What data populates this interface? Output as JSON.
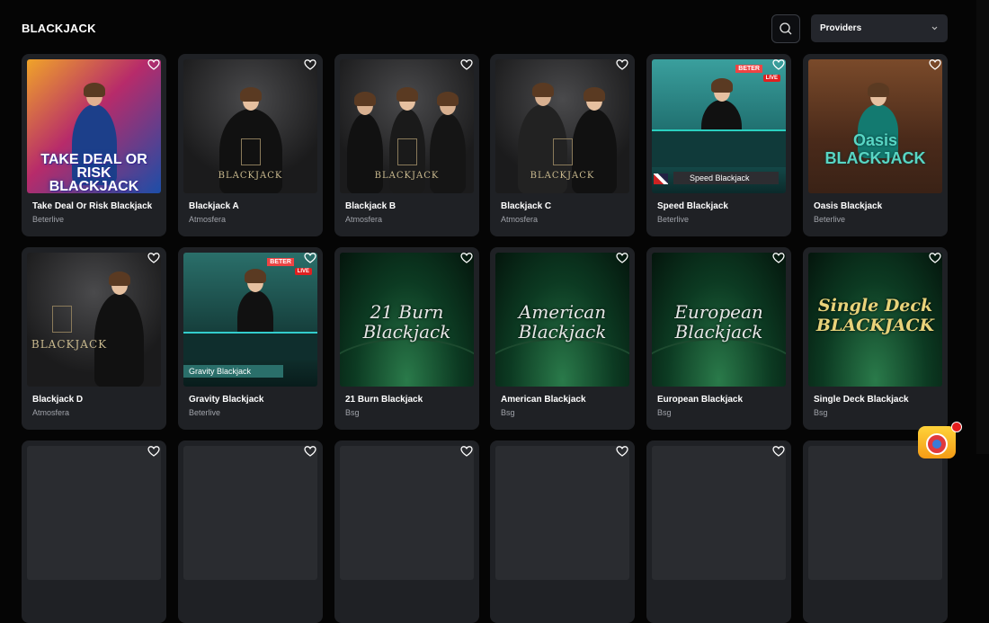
{
  "header": {
    "title": "BLACKJACK",
    "providers_label": "Providers"
  },
  "games": [
    {
      "title": "Take Deal Or Risk Blackjack",
      "provider": "Beterlive",
      "art": "take-deal",
      "logo": "TAKE DEAL OR RISK BLACKJACK"
    },
    {
      "title": "Blackjack A",
      "provider": "Atmosfera",
      "art": "atmos-single",
      "logo": "BLACKJACK"
    },
    {
      "title": "Blackjack B",
      "provider": "Atmosfera",
      "art": "atmos-trio",
      "logo": "BLACKJACK"
    },
    {
      "title": "Blackjack C",
      "provider": "Atmosfera",
      "art": "atmos-duo",
      "logo": "BLACKJACK"
    },
    {
      "title": "Speed Blackjack",
      "provider": "Beterlive",
      "art": "speed",
      "logo": "Speed Blackjack"
    },
    {
      "title": "Oasis Blackjack",
      "provider": "Beterlive",
      "art": "oasis",
      "logo": "Oasis BLACKJACK"
    },
    {
      "title": "Blackjack D",
      "provider": "Atmosfera",
      "art": "atmos-d",
      "logo": "BLACKJACK"
    },
    {
      "title": "Gravity Blackjack",
      "provider": "Beterlive",
      "art": "gravity",
      "logo": "Gravity Blackjack"
    },
    {
      "title": "21 Burn Blackjack",
      "provider": "Bsg",
      "art": "table",
      "logo": "21 Burn Blackjack"
    },
    {
      "title": "American Blackjack",
      "provider": "Bsg",
      "art": "table",
      "logo": "American Blackjack"
    },
    {
      "title": "European Blackjack",
      "provider": "Bsg",
      "art": "table",
      "logo": "European Blackjack"
    },
    {
      "title": "Single Deck Blackjack",
      "provider": "Bsg",
      "art": "single-deck",
      "logo": "Single Deck BLACKJACK"
    }
  ],
  "badges": {
    "beter": "BETER",
    "live": "LIVE"
  },
  "colors": {
    "background": "#050505",
    "card": "#1f2125",
    "provider_text": "#a0a3aa",
    "teal": "#2aa79a",
    "gold": "#d9c27a"
  }
}
